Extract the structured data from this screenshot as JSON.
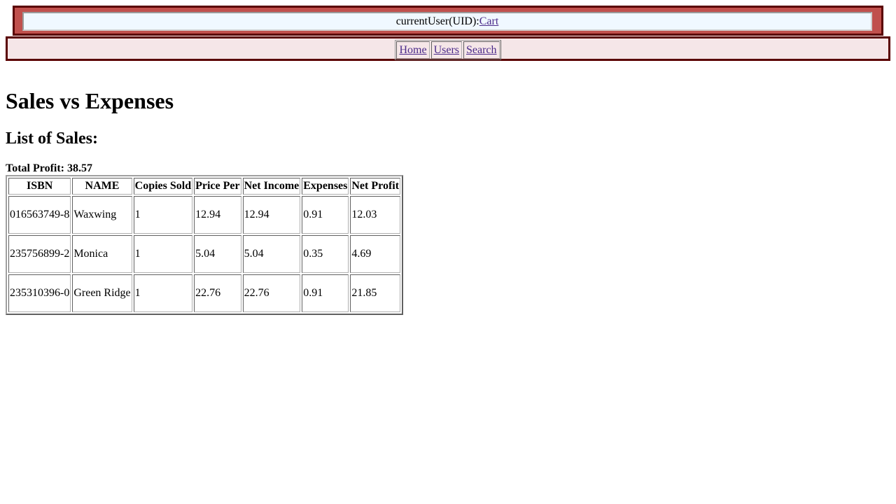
{
  "userbar": {
    "user_text": "currentUser(UID):",
    "cart_link": "Cart"
  },
  "nav": {
    "items": [
      {
        "label": "Home"
      },
      {
        "label": "Users"
      },
      {
        "label": "Search"
      }
    ]
  },
  "page": {
    "title": "Sales vs Expenses",
    "subtitle": "List of Sales:",
    "total_label": "Total Profit: ",
    "total_value": "38.57"
  },
  "sales_table": {
    "headers": [
      "ISBN",
      "NAME",
      "Copies Sold",
      "Price Per",
      "Net Income",
      "Expenses",
      "Net Profit"
    ],
    "rows": [
      [
        "016563749-8",
        "Waxwing",
        "1",
        "12.94",
        "12.94",
        "0.91",
        "12.03"
      ],
      [
        "235756899-2",
        "Monica",
        "1",
        "5.04",
        "5.04",
        "0.35",
        "4.69"
      ],
      [
        "235310396-0",
        "Green Ridge",
        "1",
        "22.76",
        "22.76",
        "0.91",
        "21.85"
      ]
    ]
  },
  "colors": {
    "userbar_border": "#5a0000",
    "userbar_bg": "#c0504d",
    "userbar_inner_bg": "#f0f8ff",
    "navbar_bg": "#f5e6e8",
    "link": "#4b2b8a"
  }
}
